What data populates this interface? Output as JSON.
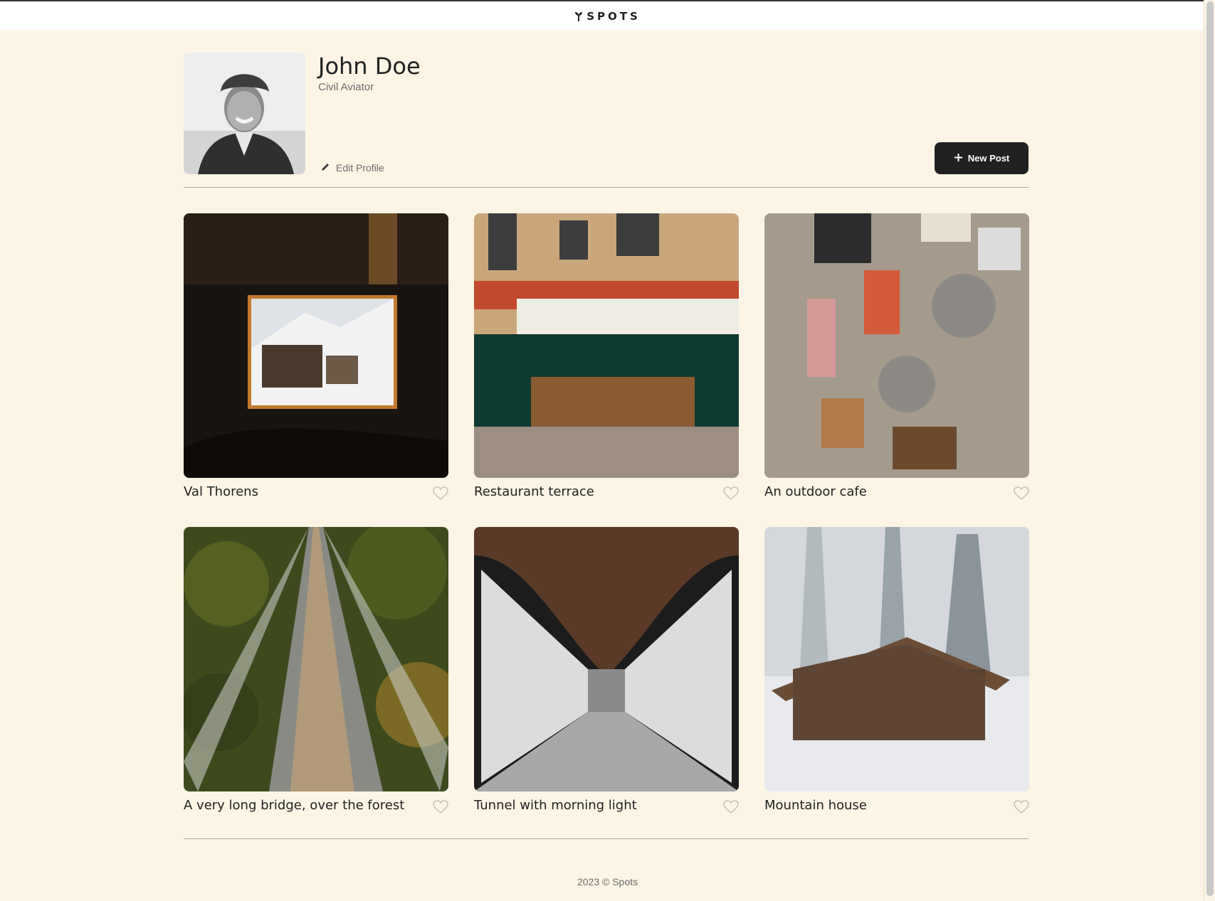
{
  "header": {
    "logo_text": "SPOTS",
    "logo_icon": "sprout-icon"
  },
  "profile": {
    "name": "John Doe",
    "description": "Civil Aviator",
    "edit_label": "Edit Profile",
    "new_post_label": "New Post"
  },
  "cards": [
    {
      "title": "Val Thorens",
      "liked": false
    },
    {
      "title": "Restaurant terrace",
      "liked": false
    },
    {
      "title": "An outdoor cafe",
      "liked": false
    },
    {
      "title": "A very long bridge, over the forest",
      "liked": false
    },
    {
      "title": "Tunnel with morning light",
      "liked": false
    },
    {
      "title": "Mountain house",
      "liked": false
    }
  ],
  "footer": {
    "text": "2023 © Spots"
  },
  "colors": {
    "background": "#fcf5e5",
    "dark": "#212121",
    "muted": "#6b6b6b",
    "divider": "#a5a5a5"
  }
}
